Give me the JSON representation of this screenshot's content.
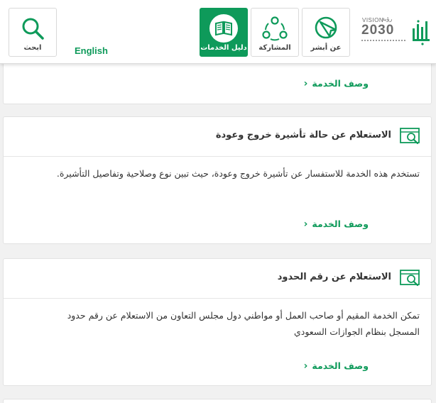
{
  "header": {
    "search_label": "ابحث",
    "language_label": "English",
    "guide_label": "دليل الخدمات",
    "participation_label": "المشاركة",
    "about_label": "عن أبشر",
    "vision_word": "VISION",
    "vision_year": "2030",
    "vision_ar": "رؤية",
    "icons": {
      "search": "search-icon",
      "guide": "book-icon",
      "participation": "people-share-icon",
      "about": "absher-mark-icon"
    }
  },
  "cards": [
    {
      "title": "",
      "description": "",
      "link_label": "وصف الخدمة"
    },
    {
      "title": "الاستعلام عن حالة تأشيرة خروج وعودة",
      "description": "تستخدم هذه الخدمة للاستفسار عن تأشيرة خروج وعودة، حيث تبين نوع وصلاحية وتفاصيل التأشيرة.",
      "link_label": "وصف الخدمة"
    },
    {
      "title": "الاستعلام عن رقم الحدود",
      "description": "تمكن الخدمة المقيم أو صاحب العمل أو مواطني دول مجلس التعاون من الاستعلام عن رقم حدود المسجل بنظام الجوازات السعودي",
      "link_label": "وصف الخدمة"
    }
  ],
  "colors": {
    "brand_green": "#0e9a5a",
    "background": "#f1f1f1",
    "text": "#333333"
  }
}
